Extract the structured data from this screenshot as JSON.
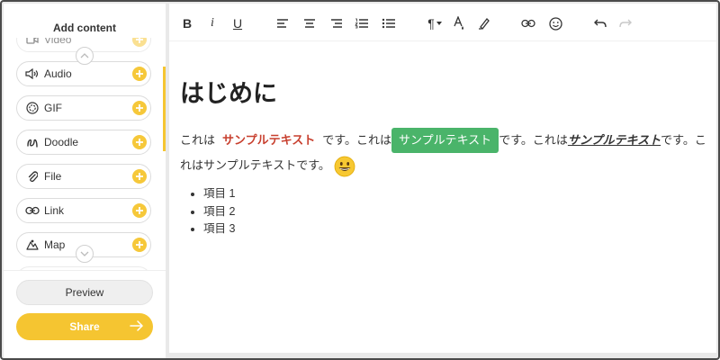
{
  "sidebar": {
    "title": "Add content",
    "items": [
      {
        "label": "Video",
        "icon": "video-icon"
      },
      {
        "label": "Audio",
        "icon": "audio-icon"
      },
      {
        "label": "GIF",
        "icon": "gif-icon"
      },
      {
        "label": "Doodle",
        "icon": "doodle-icon"
      },
      {
        "label": "File",
        "icon": "paperclip-icon"
      },
      {
        "label": "Link",
        "icon": "link-icon"
      },
      {
        "label": "Map",
        "icon": "map-icon"
      }
    ],
    "preview_label": "Preview",
    "share_label": "Share"
  },
  "toolbar": {
    "bold": "B",
    "italic": "i",
    "underline": "U",
    "tools": [
      "align-left-icon",
      "align-center-icon",
      "align-right-icon",
      "ordered-list-icon",
      "bullet-list-icon",
      "paragraph-icon",
      "text-color-icon",
      "highlighter-icon",
      "link-icon",
      "emoji-icon",
      "undo-icon",
      "redo-icon"
    ],
    "paragraph_glyph": "¶"
  },
  "document": {
    "heading": "はじめに",
    "segments": {
      "s1": "これは",
      "red": "サンプルテキスト",
      "s2": "です。これは",
      "green": "サンプルテキスト",
      "s3": "です。これは",
      "italic": "サンプルテキスト",
      "s4": "です。これはサンプルテキストです。"
    },
    "list_items": [
      "項目 1",
      "項目 2",
      "項目 3"
    ]
  },
  "colors": {
    "accent": "#f5c531",
    "red_text": "#c8402f",
    "green_highlight": "#4ab46a"
  }
}
